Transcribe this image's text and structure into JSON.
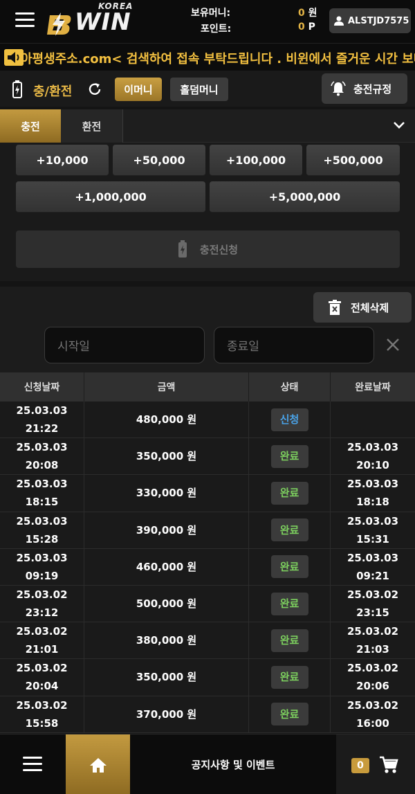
{
  "header": {
    "logo_korea": "KOREA",
    "logo_win": "WIN",
    "money_label": "보유머니:",
    "money_value": "0",
    "money_unit": "원",
    "point_label": "포인트:",
    "point_value": "0",
    "point_unit": "P",
    "username": "ALSTJD7575"
  },
  "marquee": {
    "text": "아평생주소.com< 검색하여 접속 부탁드립니다 . 비윈에서 즐거운 시간 보내시"
  },
  "titlebar": {
    "title": "충/환전",
    "money_tab": "이머니",
    "holdem_tab": "홀덤머니",
    "rules_button": "충전규정"
  },
  "tabs": {
    "charge": "충전",
    "exchange": "환전"
  },
  "amounts": [
    "+10,000",
    "+50,000",
    "+100,000",
    "+500,000",
    "+1,000,000",
    "+5,000,000"
  ],
  "apply_button": "충전신청",
  "history": {
    "delete_all": "전체삭제",
    "start_placeholder": "시작일",
    "end_placeholder": "종료일"
  },
  "table": {
    "headers": [
      "신청날짜",
      "금액",
      "상태",
      "완료날짜"
    ],
    "rows": [
      {
        "req_date": "25.03.03",
        "req_time": "21:22",
        "amount": "480,000 원",
        "status": "신청",
        "done_date": "",
        "done_time": ""
      },
      {
        "req_date": "25.03.03",
        "req_time": "20:08",
        "amount": "350,000 원",
        "status": "완료",
        "done_date": "25.03.03",
        "done_time": "20:10"
      },
      {
        "req_date": "25.03.03",
        "req_time": "18:15",
        "amount": "330,000 원",
        "status": "완료",
        "done_date": "25.03.03",
        "done_time": "18:18"
      },
      {
        "req_date": "25.03.03",
        "req_time": "15:28",
        "amount": "390,000 원",
        "status": "완료",
        "done_date": "25.03.03",
        "done_time": "15:31"
      },
      {
        "req_date": "25.03.03",
        "req_time": "09:19",
        "amount": "460,000 원",
        "status": "완료",
        "done_date": "25.03.03",
        "done_time": "09:21"
      },
      {
        "req_date": "25.03.02",
        "req_time": "23:12",
        "amount": "500,000 원",
        "status": "완료",
        "done_date": "25.03.02",
        "done_time": "23:15"
      },
      {
        "req_date": "25.03.02",
        "req_time": "21:01",
        "amount": "380,000 원",
        "status": "완료",
        "done_date": "25.03.02",
        "done_time": "21:03"
      },
      {
        "req_date": "25.03.02",
        "req_time": "20:04",
        "amount": "350,000 원",
        "status": "완료",
        "done_date": "25.03.02",
        "done_time": "20:06"
      },
      {
        "req_date": "25.03.02",
        "req_time": "15:58",
        "amount": "370,000 원",
        "status": "완료",
        "done_date": "25.03.02",
        "done_time": "16:00"
      }
    ]
  },
  "bottombar": {
    "title": "공지사항 및 이벤트",
    "cart_count": "0"
  },
  "colors": {
    "accent_gold": "#c39a40",
    "status_request": "#4aa3e8",
    "status_done": "#7ccf5e"
  },
  "icons": [
    "menu-icon",
    "user-icon",
    "speaker-icon",
    "bolt-icon",
    "refresh-icon",
    "bell-icon",
    "chevron-down-icon",
    "battery-icon",
    "trash-icon",
    "close-icon",
    "home-icon",
    "cart-icon"
  ]
}
